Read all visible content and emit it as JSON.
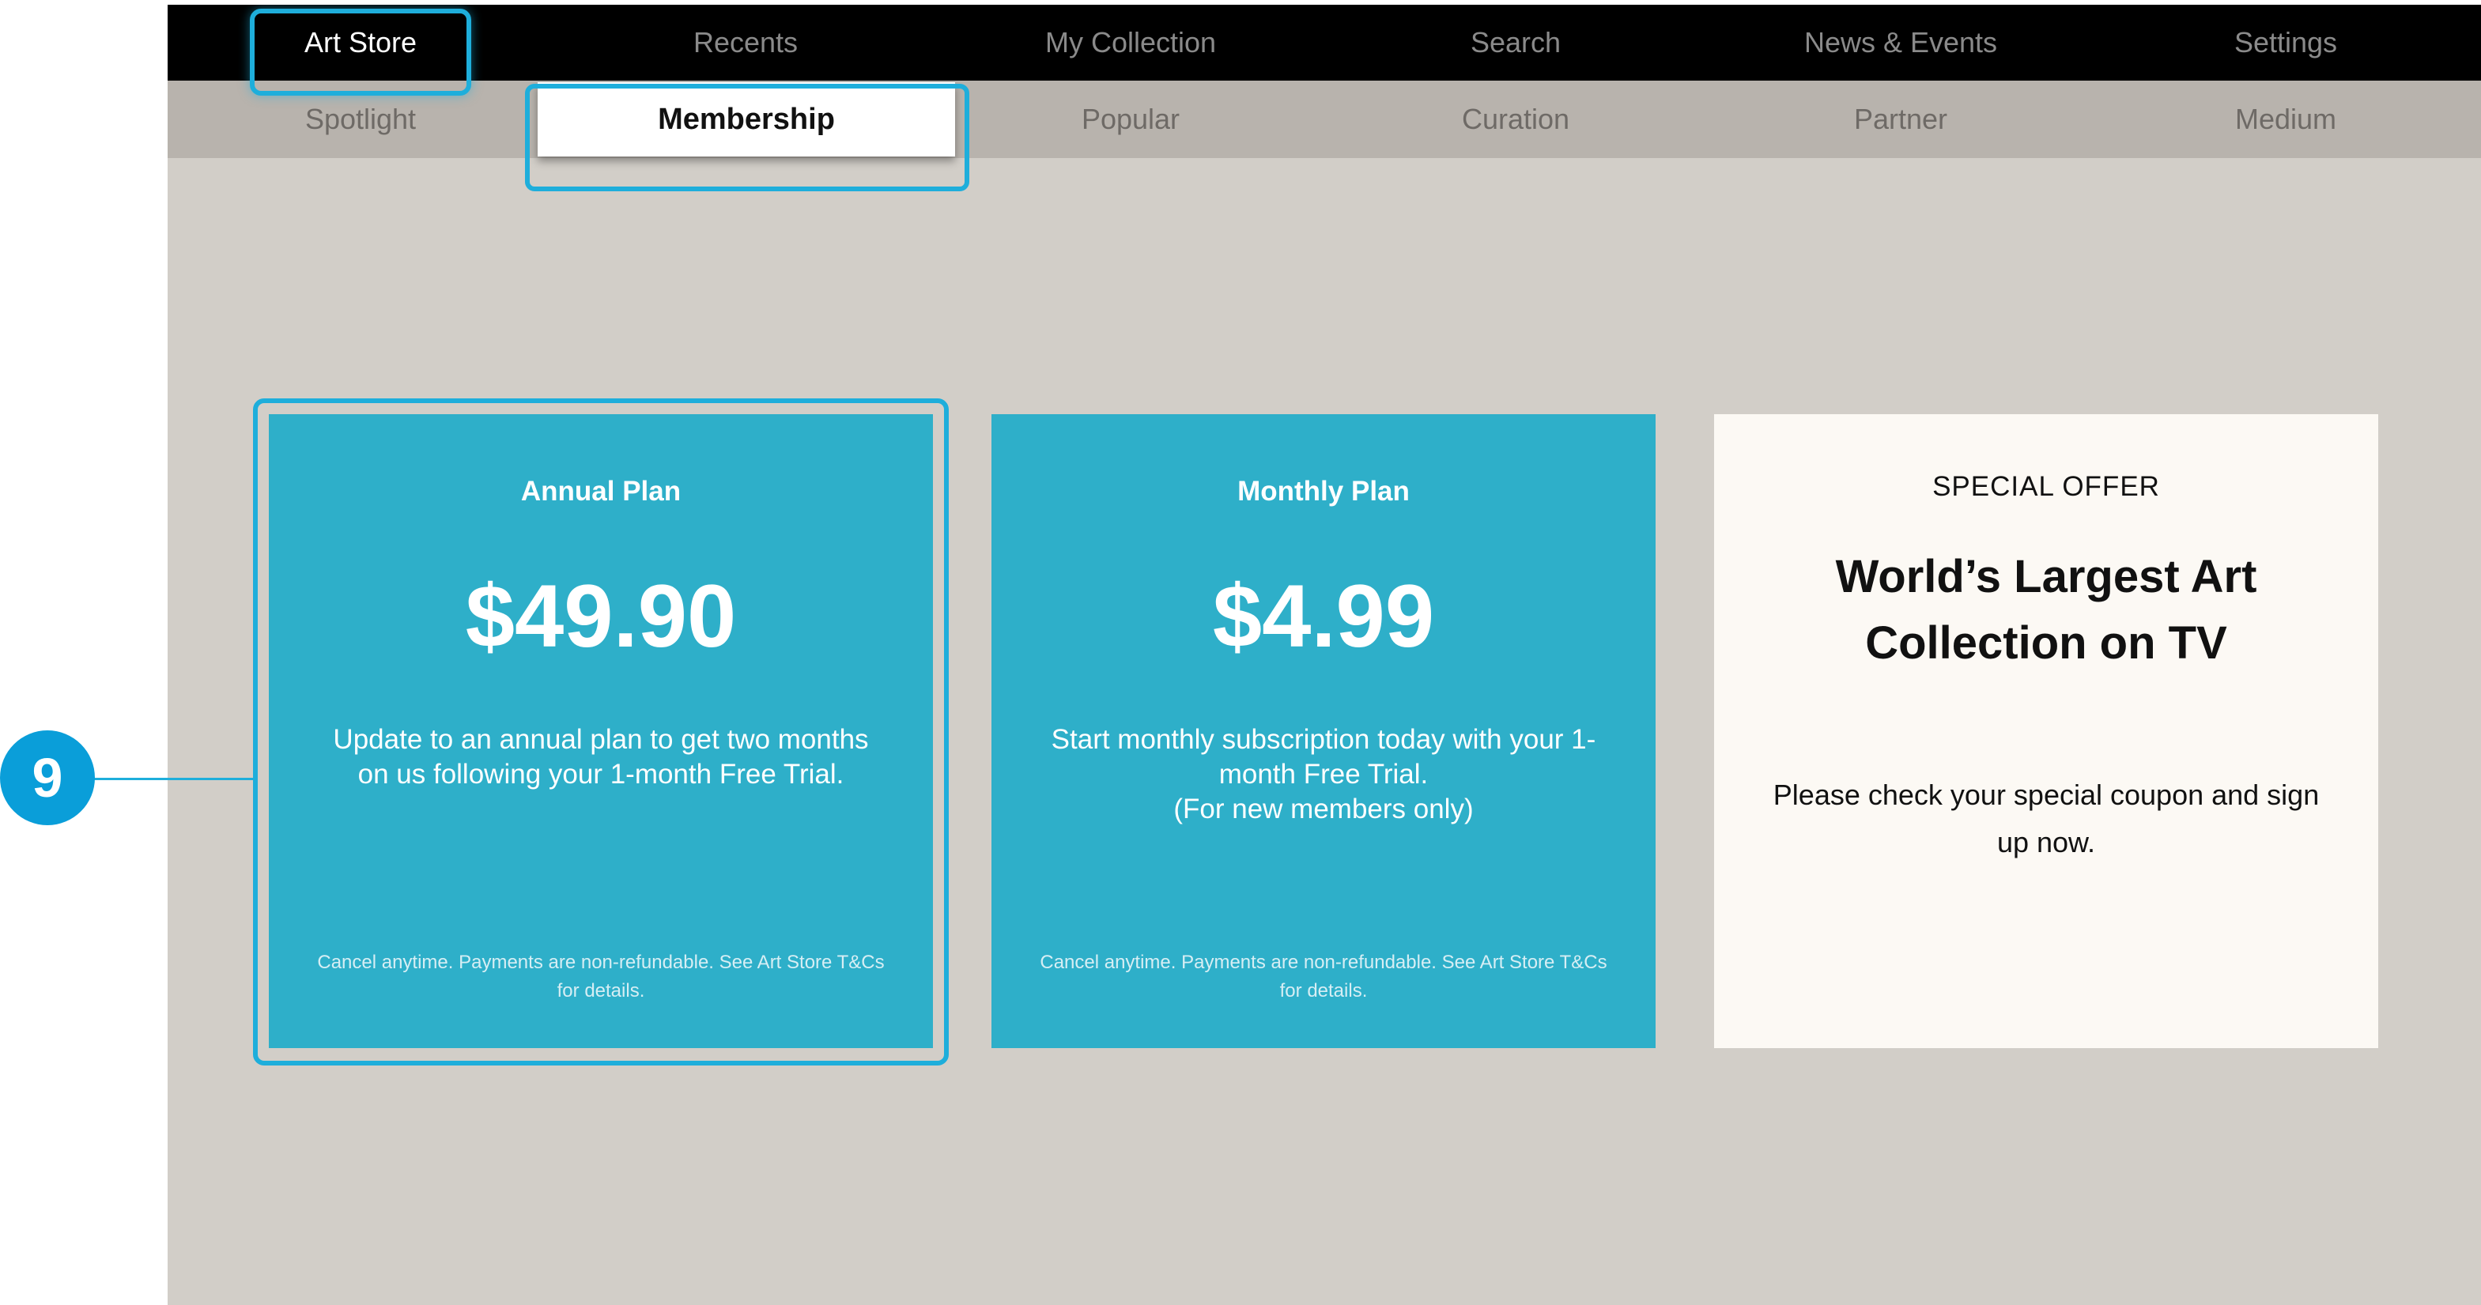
{
  "top_nav": {
    "items": [
      {
        "label": "Art Store",
        "active": true
      },
      {
        "label": "Recents",
        "active": false
      },
      {
        "label": "My Collection",
        "active": false
      },
      {
        "label": "Search",
        "active": false
      },
      {
        "label": "News & Events",
        "active": false
      },
      {
        "label": "Settings",
        "active": false
      }
    ]
  },
  "sub_nav": {
    "items": [
      {
        "label": "Spotlight",
        "selected": false
      },
      {
        "label": "Membership",
        "selected": true
      },
      {
        "label": "Popular",
        "selected": false
      },
      {
        "label": "Curation",
        "selected": false
      },
      {
        "label": "Partner",
        "selected": false
      },
      {
        "label": "Medium",
        "selected": false
      }
    ]
  },
  "cards": {
    "annual": {
      "title": "Annual Plan",
      "price": "$49.90",
      "description": "Update to an annual plan to get two months on us following your 1-month Free Trial.",
      "fine_print": "Cancel anytime. Payments are non-refundable. See Art Store T&Cs for details."
    },
    "monthly": {
      "title": "Monthly Plan",
      "price": "$4.99",
      "description": "Start monthly subscription today with your 1-month Free Trial.\n(For new members only)",
      "fine_print": "Cancel anytime. Payments are non-refundable. See Art Store T&Cs for details."
    },
    "offer": {
      "tag": "SPECIAL OFFER",
      "headline": "World’s Largest Art Collection on TV",
      "description": "Please check your special coupon and sign up now."
    }
  },
  "callout": {
    "number": "9"
  },
  "colors": {
    "focus_ring": "#1eaedb",
    "plan_card": "#2eafc9",
    "offer_card": "#fcf9f4",
    "screen_bg": "#d2cec8",
    "top_nav_bg": "#000000",
    "sub_nav_bg": "#b8b3ad"
  }
}
